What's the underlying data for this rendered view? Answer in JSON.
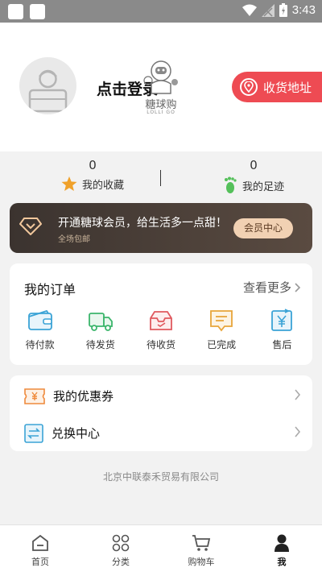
{
  "status_bar": {
    "time": "3:43"
  },
  "header": {
    "login_text": "点击登录",
    "brand_name": "糖球购",
    "brand_sub": "LOLLI GO",
    "address_button": "收货地址"
  },
  "stats": [
    {
      "count": "0",
      "label": "我的收藏"
    },
    {
      "count": "0",
      "label": "我的足迹"
    }
  ],
  "vip": {
    "title": "开通糖球会员，给生活多一点甜！",
    "subtitle": "全场包邮",
    "button": "会员中心"
  },
  "orders": {
    "title": "我的订单",
    "more": "查看更多",
    "items": [
      {
        "label": "待付款",
        "icon": "wallet-icon"
      },
      {
        "label": "待发货",
        "icon": "truck-icon"
      },
      {
        "label": "待收货",
        "icon": "inbox-icon"
      },
      {
        "label": "已完成",
        "icon": "message-icon"
      },
      {
        "label": "售后",
        "icon": "yen-return-icon"
      }
    ]
  },
  "tools": [
    {
      "label": "我的优惠券",
      "icon": "coupon-icon"
    },
    {
      "label": "兑换中心",
      "icon": "exchange-icon"
    }
  ],
  "footer": {
    "company": "北京中联泰禾贸易有限公司"
  },
  "tabbar": [
    {
      "label": "首页",
      "icon": "home-icon",
      "active": false
    },
    {
      "label": "分类",
      "icon": "category-icon",
      "active": false
    },
    {
      "label": "购物车",
      "icon": "cart-icon",
      "active": false
    },
    {
      "label": "我",
      "icon": "profile-icon",
      "active": true
    }
  ],
  "colors": {
    "accent_red": "#ee4b53",
    "vip_gold": "#f1d1b3",
    "star": "#f0a12a",
    "footprint": "#54c05a"
  }
}
